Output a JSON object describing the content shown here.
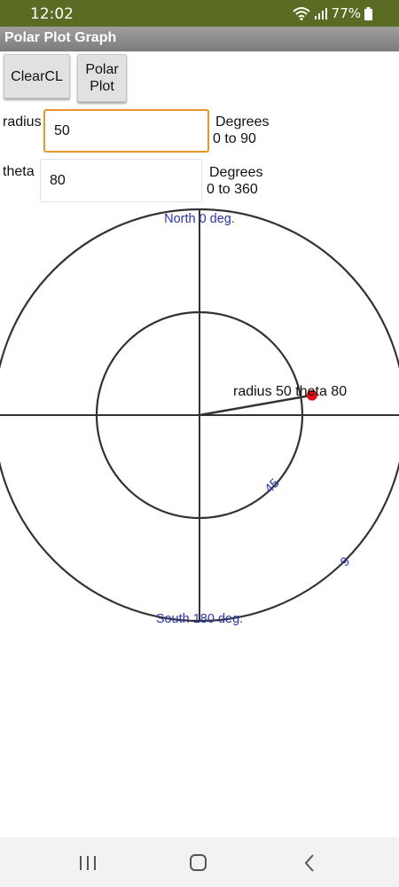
{
  "status_bar": {
    "time": "12:02",
    "battery": "77%",
    "background": "#5a6c23"
  },
  "app": {
    "title": "Polar Plot Graph"
  },
  "buttons": {
    "clear_label": "ClearCL",
    "polar_label": "Polar\nPlot"
  },
  "inputs": {
    "radius_label": "radius",
    "radius_value": "50",
    "radius_range_line1": "Degrees",
    "radius_range_line2": "0 to 90",
    "theta_label": "theta",
    "theta_value": "80",
    "theta_range_line1": "Degrees",
    "theta_range_line2": "0 to 360",
    "focus_color": "#e8952b"
  },
  "plot": {
    "north_label": "North 0 deg.",
    "south_label": "South 180 deg.",
    "ring_label_inner": "45",
    "ring_label_outer": "9",
    "point_label": "radius 50 theta 80",
    "point_radius": 50,
    "point_theta": 80,
    "point_color": "#e01010",
    "ring_values": [
      45,
      90
    ],
    "label_color": "#2b35a8",
    "line_color": "#333333"
  },
  "nav_bar": {
    "icons": [
      "recents-icon",
      "home-icon",
      "back-icon"
    ]
  }
}
